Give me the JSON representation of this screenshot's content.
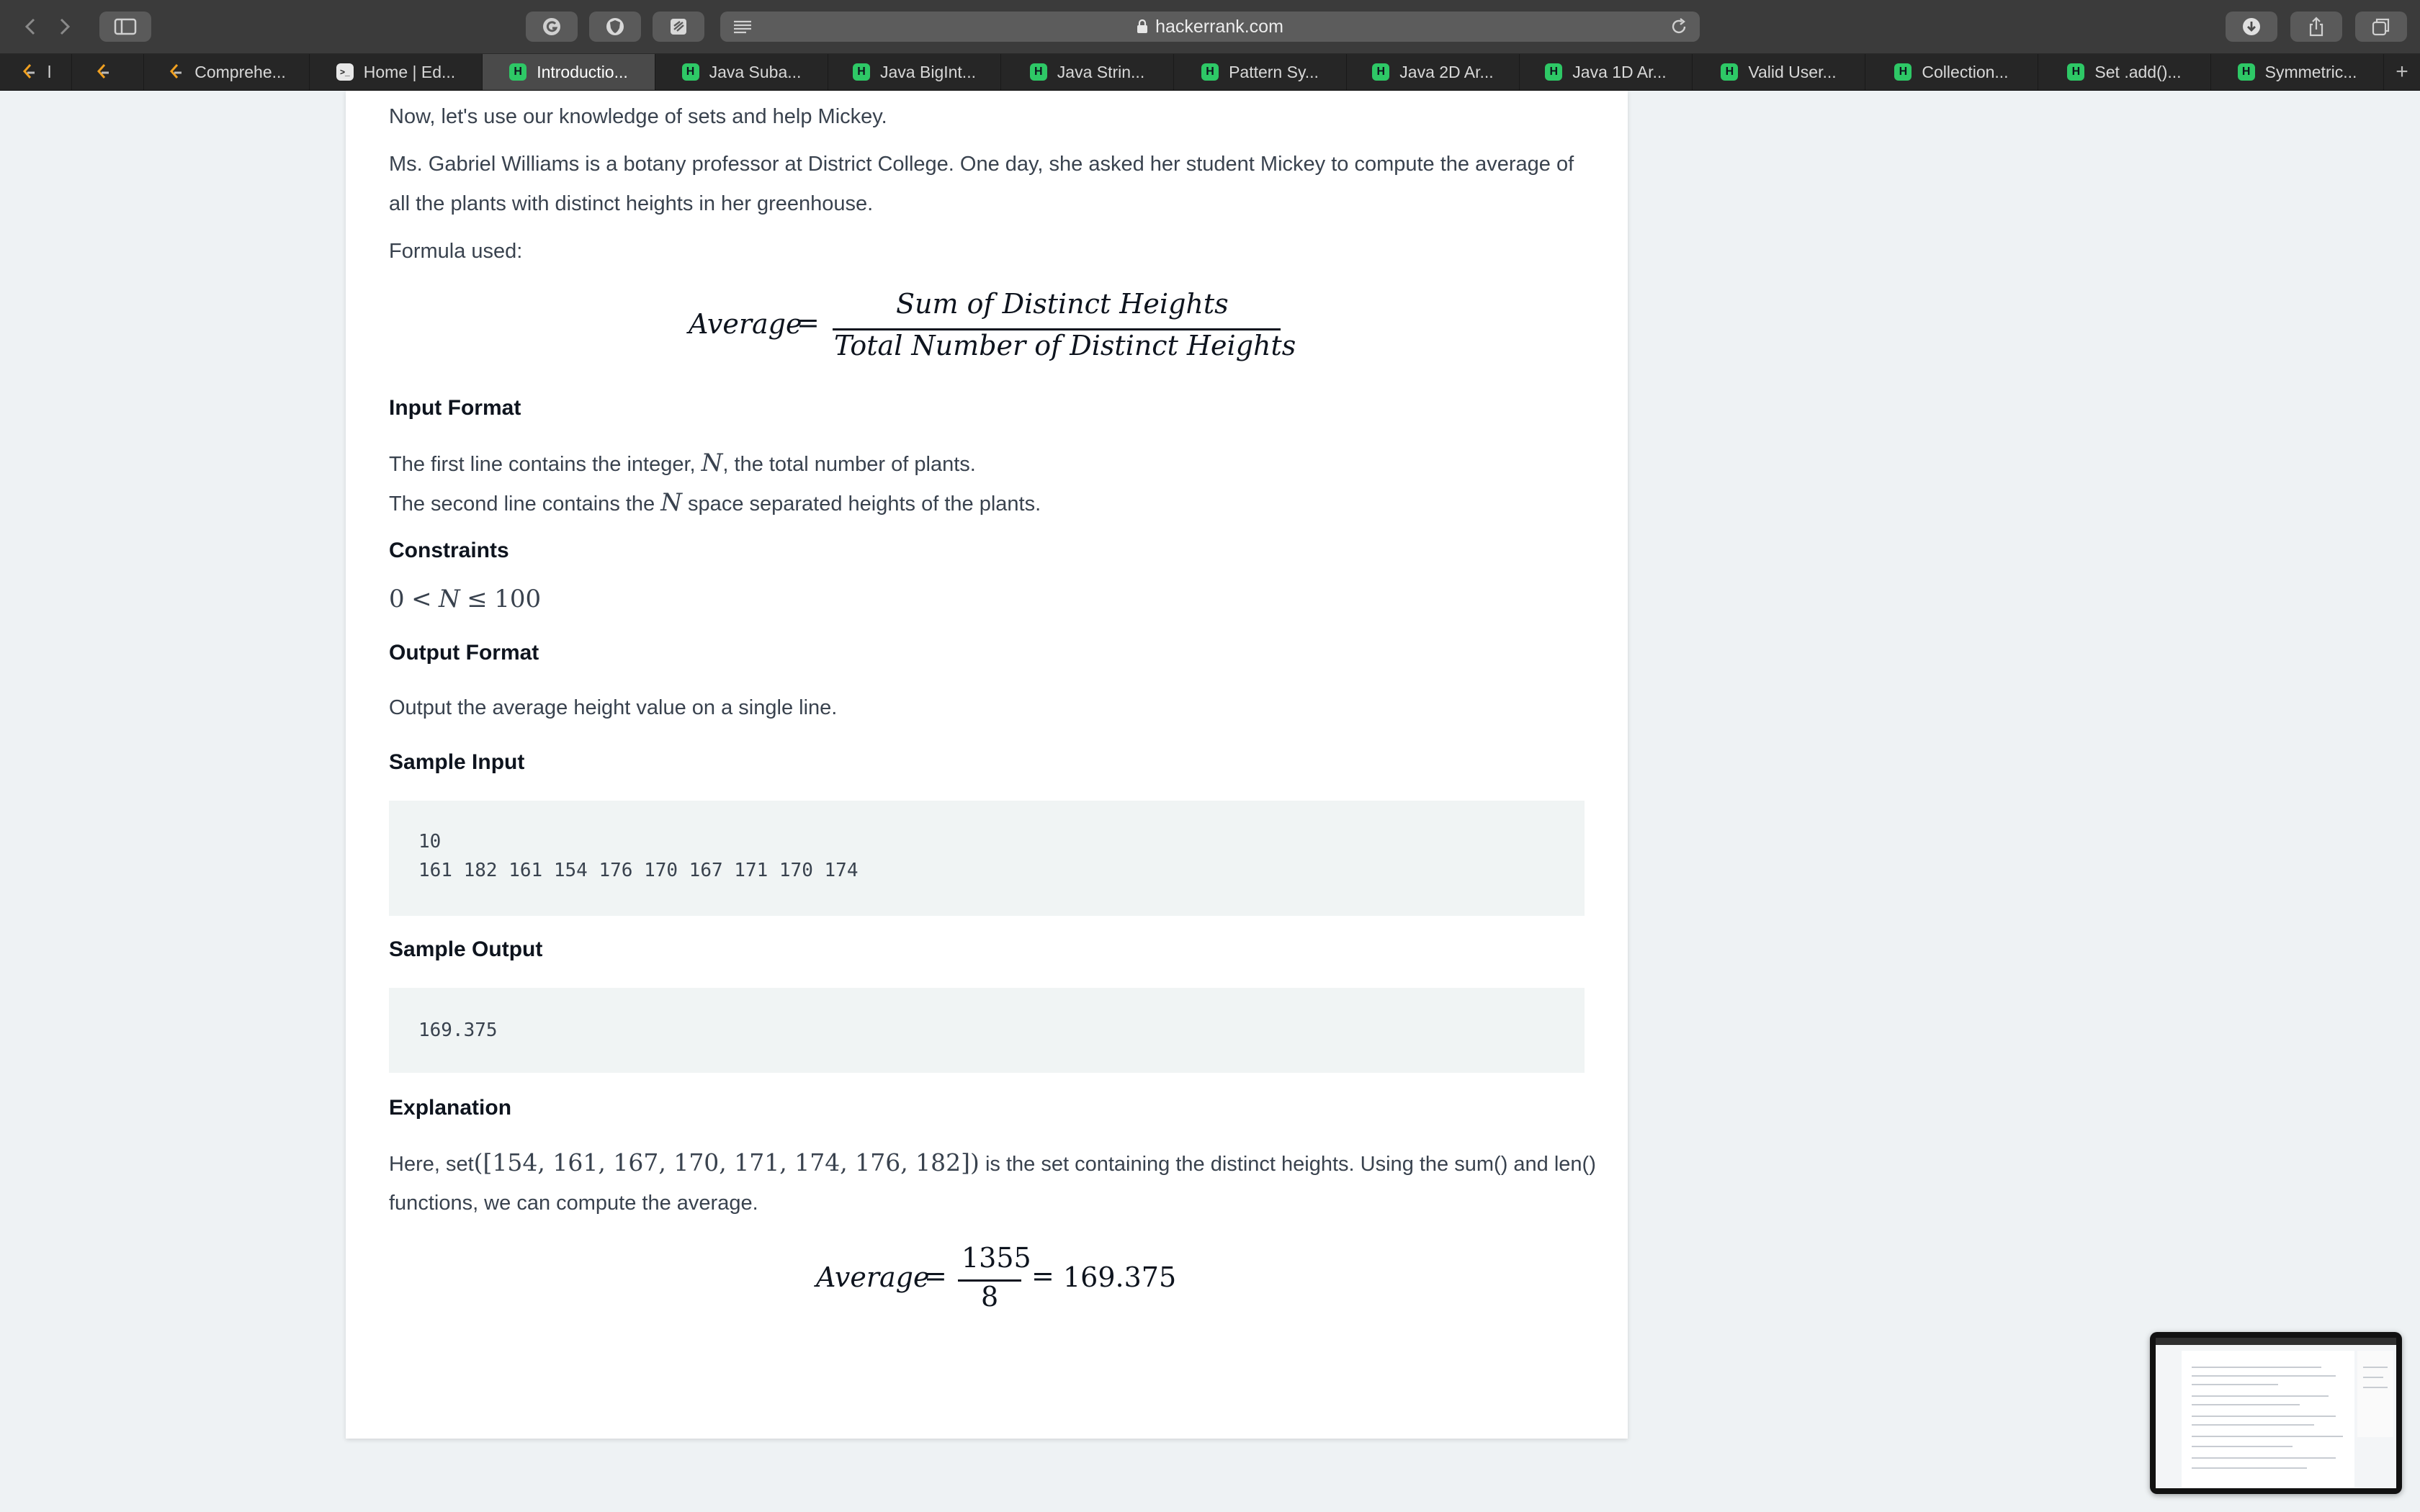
{
  "browser": {
    "url": "hackerrank.com",
    "tabs": [
      {
        "label": "l",
        "icon": "leetcode-icon"
      },
      {
        "label": "",
        "icon": "leetcode-icon"
      },
      {
        "label": "Comprehe...",
        "icon": "leetcode-icon"
      },
      {
        "label": "Home | Ed...",
        "icon": "terminal-icon"
      },
      {
        "label": "Introductio...",
        "icon": "hackerrank-icon",
        "active": true
      },
      {
        "label": "Java Suba...",
        "icon": "hackerrank-icon"
      },
      {
        "label": "Java BigInt...",
        "icon": "hackerrank-icon"
      },
      {
        "label": "Java Strin...",
        "icon": "hackerrank-icon"
      },
      {
        "label": "Pattern Sy...",
        "icon": "hackerrank-icon"
      },
      {
        "label": "Java 2D Ar...",
        "icon": "hackerrank-icon"
      },
      {
        "label": "Java 1D Ar...",
        "icon": "hackerrank-icon"
      },
      {
        "label": "Valid User...",
        "icon": "hackerrank-icon"
      },
      {
        "label": "Collection...",
        "icon": "hackerrank-icon"
      },
      {
        "label": "Set .add()...",
        "icon": "hackerrank-icon"
      },
      {
        "label": "Symmetric...",
        "icon": "hackerrank-icon"
      }
    ],
    "new_tab": "+"
  },
  "problem": {
    "intro": "Now, let's use our knowledge of sets and help Mickey.",
    "story_line1": "Ms. Gabriel Williams is a botany professor at District College. One day, she asked her student Mickey to compute the average of",
    "story_line2": "all the plants with distinct heights in her greenhouse.",
    "formula_label": "Formula used:",
    "formula": {
      "lhs": "Average",
      "eq": "=",
      "numerator": "Sum of Distinct Heights",
      "denominator": "Total Number of Distinct Heights"
    },
    "input_format": {
      "title": "Input Format",
      "line1_pre": "The first line contains the integer, ",
      "line1_var": "N",
      "line1_post": ", the total number of plants.",
      "line2_pre": "The second line contains the ",
      "line2_var": "N",
      "line2_post": " space separated heights of the plants."
    },
    "constraints": {
      "title": "Constraints",
      "lhs": "0",
      "lt": "<",
      "var": "N",
      "le": "≤",
      "rhs": "100"
    },
    "output_format": {
      "title": "Output Format",
      "text": "Output the average height value on a single line."
    },
    "sample_input": {
      "title": "Sample Input",
      "line1": "10",
      "line2": "161 182 161 154 176 170 167 171 170 174"
    },
    "sample_output": {
      "title": "Sample Output",
      "line1": "169.375"
    },
    "explanation": {
      "title": "Explanation",
      "pre": "Here, set",
      "set_math": "([154, 161, 167, 170, 171, 174, 176, 182])",
      "post": " is the set containing the distinct heights. Using the sum() and len()",
      "line2": "functions, we can compute the average.",
      "formula": {
        "lhs": "Average",
        "eq": "=",
        "numerator": "1355",
        "denominator": "8",
        "eq2": "=",
        "result": "169.375"
      }
    }
  }
}
